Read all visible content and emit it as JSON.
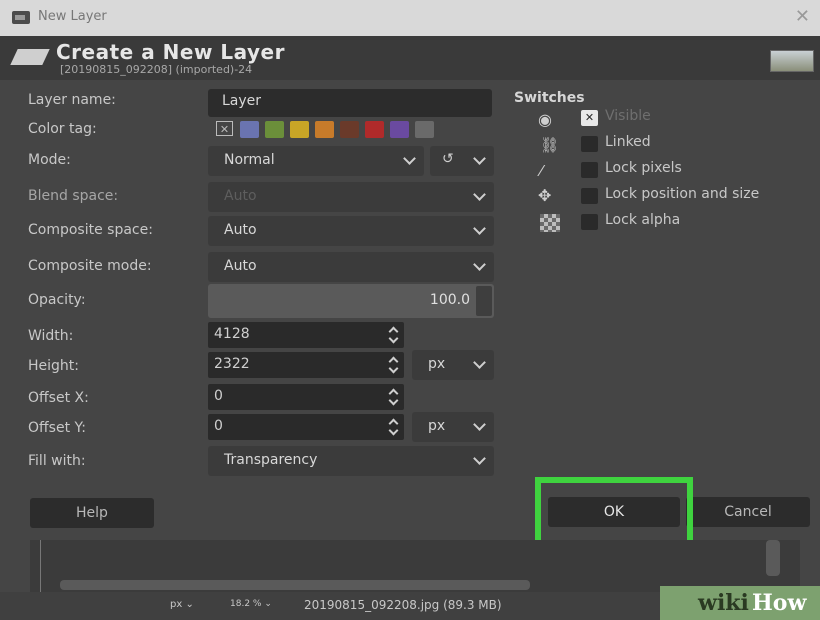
{
  "window": {
    "title": "New Layer"
  },
  "header": {
    "title": "Create a New Layer",
    "subtitle": "[20190815_092208] (imported)-24"
  },
  "form": {
    "layer_name": {
      "label": "Layer name:",
      "value": "Layer"
    },
    "color_tag": {
      "label": "Color tag:",
      "swatches": [
        "#6a74b0",
        "#6b8f3a",
        "#c8a526",
        "#c77b2a",
        "#6a3a2a",
        "#b02a2a",
        "#6a4aa0",
        "#6a6a6a"
      ]
    },
    "mode": {
      "label": "Mode:",
      "value": "Normal"
    },
    "blend_space": {
      "label": "Blend space:",
      "value": "Auto"
    },
    "composite_space": {
      "label": "Composite space:",
      "value": "Auto"
    },
    "composite_mode": {
      "label": "Composite mode:",
      "value": "Auto"
    },
    "opacity": {
      "label": "Opacity:",
      "value": "100.0"
    },
    "width": {
      "label": "Width:",
      "value": "4128"
    },
    "height": {
      "label": "Height:",
      "value": "2322",
      "unit": "px"
    },
    "offset_x": {
      "label": "Offset X:",
      "value": "0"
    },
    "offset_y": {
      "label": "Offset Y:",
      "value": "0",
      "unit": "px"
    },
    "fill_with": {
      "label": "Fill with:",
      "value": "Transparency"
    }
  },
  "switches": {
    "title": "Switches",
    "items": [
      {
        "label": "Visible",
        "checked": true,
        "icon": "eye-icon"
      },
      {
        "label": "Linked",
        "checked": false,
        "icon": "chain-icon"
      },
      {
        "label": "Lock pixels",
        "checked": false,
        "icon": "brush-icon"
      },
      {
        "label": "Lock position and size",
        "checked": false,
        "icon": "move-arrows-icon"
      },
      {
        "label": "Lock alpha",
        "checked": false,
        "icon": "checkerboard-icon"
      }
    ]
  },
  "buttons": {
    "help": "Help",
    "ok": "OK",
    "cancel": "Cancel"
  },
  "status": {
    "unit": "px",
    "zoom": "18.2 %",
    "file": "20190815_092208.jpg (89.3 MB)"
  },
  "watermark": {
    "wiki": "wiki",
    "how": "How"
  },
  "colors": {
    "highlight": "#3fd33f",
    "watermark_bg": "#7da16f"
  }
}
